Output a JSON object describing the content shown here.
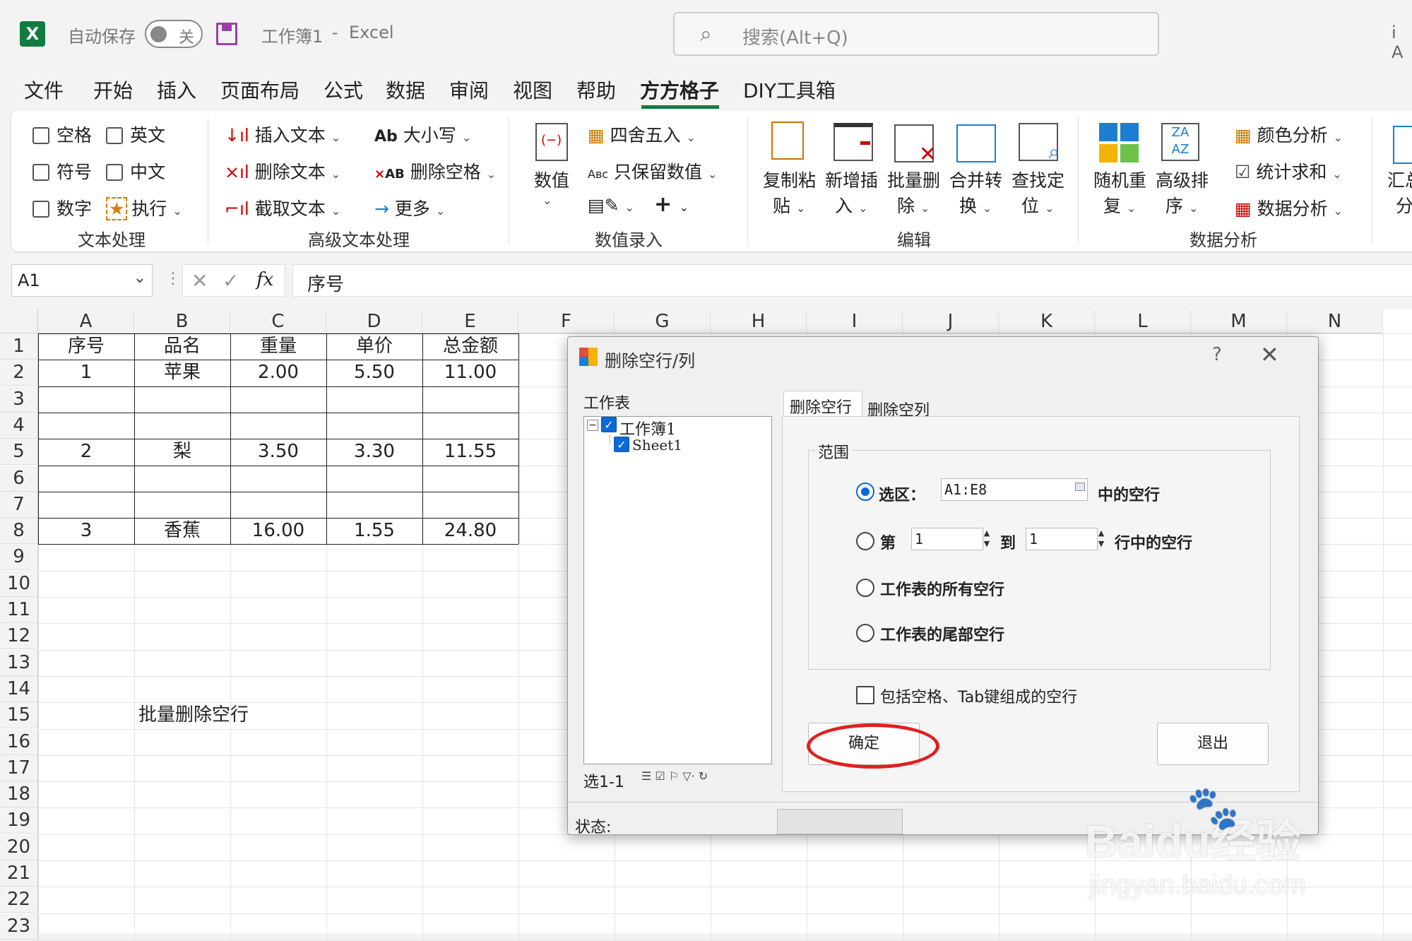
{
  "titlebar": {
    "autosave_label": "自动保存",
    "toggle_label": "关",
    "doc_title": "工作簿1",
    "separator": "-",
    "app_name": "Excel",
    "search_placeholder": "搜索(Alt+Q)",
    "right_text": "i A"
  },
  "menu": [
    "文件",
    "开始",
    "插入",
    "页面布局",
    "公式",
    "数据",
    "审阅",
    "视图",
    "帮助",
    "方方格子",
    "DIY工具箱"
  ],
  "ribbon": {
    "text_group": {
      "items": [
        "空格",
        "英文",
        "符号",
        "中文",
        "数字",
        "执行"
      ],
      "label": "文本处理"
    },
    "adv_text_group": {
      "items": [
        "插入文本",
        "删除文本",
        "截取文本",
        "大小写",
        "删除空格",
        "更多"
      ],
      "label": "高级文本处理"
    },
    "value_group": {
      "big": "数值",
      "items": [
        "四舍五入",
        "只保留数值",
        "+"
      ],
      "label": "数值录入"
    },
    "edit_group": {
      "items": [
        {
          "line1": "复制粘",
          "line2": "贴"
        },
        {
          "line1": "新增插",
          "line2": "入"
        },
        {
          "line1": "批量删",
          "line2": "除"
        },
        {
          "line1": "合并转",
          "line2": "换"
        },
        {
          "line1": "查找定",
          "line2": "位"
        }
      ],
      "label": "编辑"
    },
    "analysis_group": {
      "big": [
        {
          "line1": "随机重",
          "line2": "复"
        },
        {
          "line1": "高级排",
          "line2": "序"
        }
      ],
      "items": [
        "颜色分析",
        "统计求和",
        "数据分析"
      ],
      "label": "数据分析"
    },
    "cut_group": {
      "line1": "汇总",
      "line2": "分"
    }
  },
  "formula_bar": {
    "cell_ref": "A1",
    "fx": "fx",
    "content": "序号"
  },
  "sheet": {
    "columns": [
      "A",
      "B",
      "C",
      "D",
      "E",
      "F",
      "G",
      "H",
      "I",
      "J",
      "K",
      "L",
      "M",
      "N"
    ],
    "rows": [
      "1",
      "2",
      "3",
      "4",
      "5",
      "6",
      "7",
      "8",
      "9",
      "10",
      "11",
      "12",
      "13",
      "14",
      "15",
      "16",
      "17",
      "18",
      "19",
      "20",
      "21",
      "22",
      "23"
    ],
    "headers": [
      "序号",
      "品名",
      "重量",
      "单价",
      "总金额"
    ],
    "data": [
      [
        "1",
        "苹果",
        "2.00",
        "5.50",
        "11.00"
      ],
      [
        "",
        "",
        "",
        "",
        ""
      ],
      [
        "",
        "",
        "",
        "",
        ""
      ],
      [
        "2",
        "梨",
        "3.50",
        "3.30",
        "11.55"
      ],
      [
        "",
        "",
        "",
        "",
        ""
      ],
      [
        "",
        "",
        "",
        "",
        ""
      ],
      [
        "3",
        "香蕉",
        "16.00",
        "1.55",
        "24.80"
      ]
    ],
    "note_cell": "批量删除空行"
  },
  "dialog": {
    "title": "删除空行/列",
    "help": "?",
    "close": "✕",
    "worksheet_label": "工作表",
    "tree_root": "工作簿1",
    "tree_child": "Sheet1",
    "tree_status": "选1-1",
    "tab_rows": "删除空行",
    "tab_cols": "删除空列",
    "range_label": "范围",
    "opt_selection": "选区：",
    "selection_value": "A1:E8",
    "in_blank_rows": "中的空行",
    "opt_rows_from": "第",
    "from_value": "1",
    "to_label": "到",
    "to_value": "1",
    "rows_blank_suffix": "行中的空行",
    "opt_all_blank": "工作表的所有空行",
    "opt_tail_blank": "工作表的尾部空行",
    "include_spaces": "包括空格、Tab键组成的空行",
    "ok": "确定",
    "exit": "退出",
    "status_label": "状态:"
  },
  "watermark": {
    "brand": "Baidu经验",
    "url": "jingyan.baidu.com"
  },
  "colors": {
    "excel_green": "#107c41",
    "accent_blue": "#0a6ad6",
    "annotation_red": "#e02020"
  }
}
